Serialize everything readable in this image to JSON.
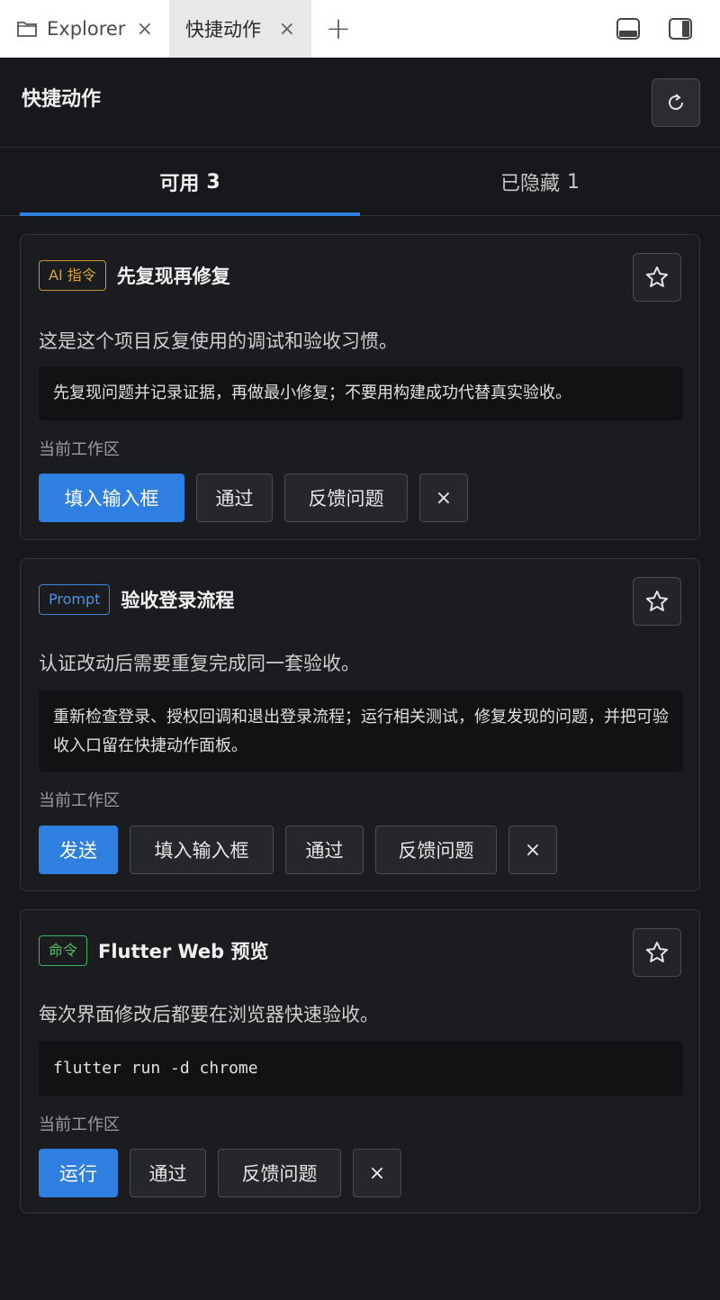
{
  "tabs": [
    {
      "label": "Explorer",
      "close": "×"
    },
    {
      "label": "快捷动作",
      "close": "×"
    }
  ],
  "add_tab": "+",
  "header": {
    "title": "快捷动作"
  },
  "segments": [
    {
      "label": "可用",
      "count": "3"
    },
    {
      "label": "已隐藏",
      "count": "1"
    }
  ],
  "cards": [
    {
      "badge": "AI 指令",
      "title": "先复现再修复",
      "desc": "这是这个项目反复使用的调试和验收习惯。",
      "code": "先复现问题并记录证据，再做最小修复；不要用构建成功代替真实验收。",
      "workspace": "当前工作区",
      "buttons": [
        "填入输入框",
        "通过",
        "反馈问题",
        "×"
      ]
    },
    {
      "badge": "Prompt",
      "title": "验收登录流程",
      "desc": "认证改动后需要重复完成同一套验收。",
      "code": "重新检查登录、授权回调和退出登录流程；运行相关测试，修复发现的问题，并把可验收入口留在快捷动作面板。",
      "workspace": "当前工作区",
      "buttons": [
        "发送",
        "填入输入框",
        "通过",
        "反馈问题",
        "×"
      ]
    },
    {
      "badge": "命令",
      "title": "Flutter Web 预览",
      "desc": "每次界面修改后都要在浏览器快速验收。",
      "code": "flutter run -d chrome",
      "workspace": "当前工作区",
      "buttons": [
        "运行",
        "通过",
        "反馈问题",
        "×"
      ]
    }
  ],
  "colors": {
    "accent": "#2f7fe0",
    "badge_ai": "#d4a534",
    "badge_prompt": "#4d92e8",
    "badge_cmd": "#4cc26a"
  }
}
